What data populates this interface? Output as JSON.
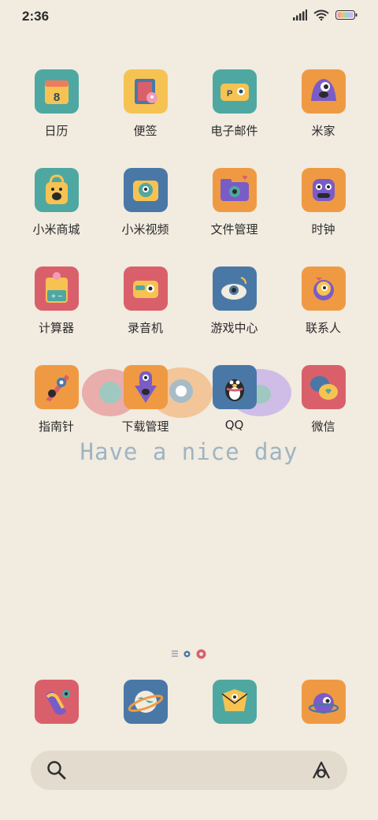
{
  "status": {
    "time": "2:36",
    "icons": [
      "signal-icon",
      "wifi-icon",
      "battery-icon"
    ]
  },
  "apps": [
    {
      "label": "日历",
      "icon": "calendar-icon",
      "color": "#4ea8a1"
    },
    {
      "label": "便签",
      "icon": "notes-icon",
      "color": "#f6c352"
    },
    {
      "label": "电子邮件",
      "icon": "email-icon",
      "color": "#4ea8a1"
    },
    {
      "label": "米家",
      "icon": "mijia-icon",
      "color": "#ef9a43"
    },
    {
      "label": "小米商城",
      "icon": "mi-store-icon",
      "color": "#4ea8a1"
    },
    {
      "label": "小米视频",
      "icon": "mi-video-icon",
      "color": "#4a78a6"
    },
    {
      "label": "文件管理",
      "icon": "file-manager-icon",
      "color": "#ef9a43"
    },
    {
      "label": "时钟",
      "icon": "clock-icon",
      "color": "#ef9a43"
    },
    {
      "label": "计算器",
      "icon": "calculator-icon",
      "color": "#d9606a"
    },
    {
      "label": "录音机",
      "icon": "recorder-icon",
      "color": "#d9606a"
    },
    {
      "label": "游戏中心",
      "icon": "game-center-icon",
      "color": "#4a78a6"
    },
    {
      "label": "联系人",
      "icon": "contacts-icon",
      "color": "#ef9a43"
    },
    {
      "label": "指南针",
      "icon": "compass-icon",
      "color": "#ef9a43"
    },
    {
      "label": "下载管理",
      "icon": "download-manager-icon",
      "color": "#ef9a43"
    },
    {
      "label": "QQ",
      "icon": "qq-icon",
      "color": "#4a78a6"
    },
    {
      "label": "微信",
      "icon": "wechat-icon",
      "color": "#d9606a"
    }
  ],
  "wallpaper_text": "Have a nice day",
  "page_indicator": {
    "pages": 3,
    "current": 3
  },
  "dock": [
    {
      "icon": "phone-icon",
      "color": "#d9606a"
    },
    {
      "icon": "browser-icon",
      "color": "#4a78a6"
    },
    {
      "icon": "messages-icon",
      "color": "#4ea8a1"
    },
    {
      "icon": "camera-icon",
      "color": "#ef9a43"
    }
  ],
  "search": {
    "search_icon": "search-icon",
    "assistant_icon": "assistant-icon"
  }
}
